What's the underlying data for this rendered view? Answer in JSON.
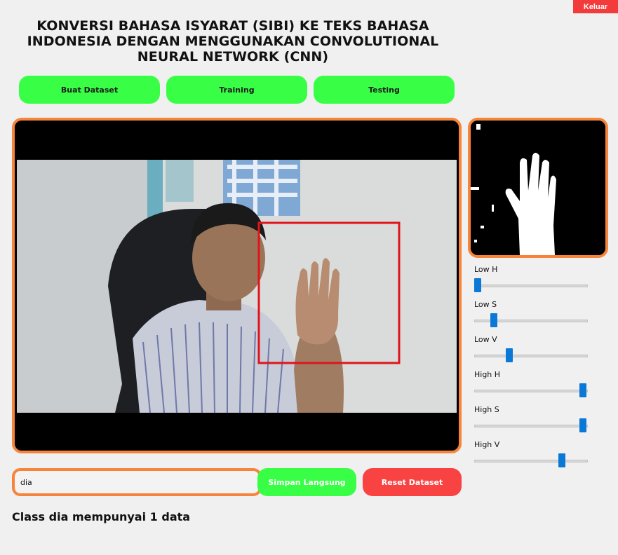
{
  "header": {
    "exit_label": "Keluar",
    "title": "KONVERSI BAHASA ISYARAT (SIBI) KE TEKS BAHASA INDONESIA DENGAN MENGGUNAKAN CONVOLUTIONAL NEURAL NETWORK (CNN)"
  },
  "nav": {
    "buat_dataset": "Buat Dataset",
    "training": "Training",
    "testing": "Testing"
  },
  "sliders": [
    {
      "label": "Low H",
      "value": 0.0
    },
    {
      "label": "Low S",
      "value": 0.15
    },
    {
      "label": "Low V",
      "value": 0.3
    },
    {
      "label": "High H",
      "value": 1.0
    },
    {
      "label": "High S",
      "value": 1.0
    },
    {
      "label": "High V",
      "value": 0.8
    }
  ],
  "form": {
    "class_value": "dia",
    "save_label": "Simpan Langsung",
    "reset_label": "Reset Dataset"
  },
  "status": "Class dia mempunyai 1 data",
  "colors": {
    "accent_orange": "#f7843b",
    "button_green": "#38ff46",
    "button_red": "#f94343",
    "exit_red": "#f33b3b",
    "slider_thumb": "#0a78d7"
  }
}
